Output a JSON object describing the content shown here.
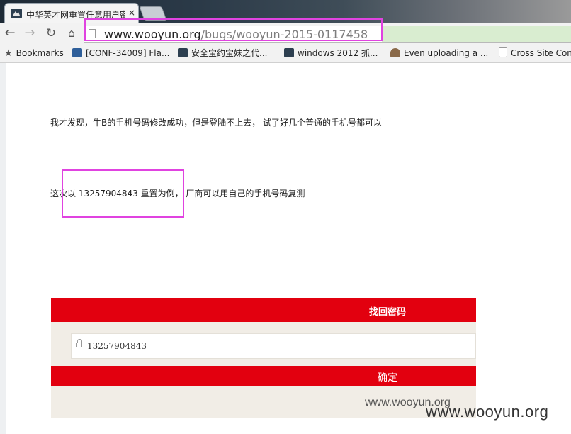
{
  "tab": {
    "title": "中华英才网重置任意用户密",
    "close": "×"
  },
  "toolbar": {
    "back": "←",
    "forward": "→",
    "reload": "↻",
    "home": "⌂",
    "url_host": "www.wooyun.org",
    "url_path": "/bugs/wooyun-2015-0117458"
  },
  "bookmarks": [
    {
      "label": "Bookmarks",
      "icon": "star-icon"
    },
    {
      "label": "[CONF-34009] Fla...",
      "icon": "confluence-icon"
    },
    {
      "label": "安全宝约宝妹之代...",
      "icon": "wooyun-icon"
    },
    {
      "label": "windows 2012 抓...",
      "icon": "wooyun-icon"
    },
    {
      "label": "Even uploading a ...",
      "icon": "user-icon"
    },
    {
      "label": "Cross Site Con",
      "icon": "page-icon"
    }
  ],
  "content": {
    "para1": "我才发现，牛B的手机号码修改成功，但是登陆不上去， 试了好几个普通的手机号都可以",
    "para2": "这次以 13257904843 重置为例， 厂商可以用自己的手机号码复测"
  },
  "embed": {
    "title": "找回密码",
    "phone": "13257904843",
    "confirm": "确定",
    "watermark": "www.wooyun.org"
  },
  "watermark": "www.wooyun.org",
  "colors": {
    "brand_red": "#e2000f",
    "highlight": "#e043e0"
  }
}
